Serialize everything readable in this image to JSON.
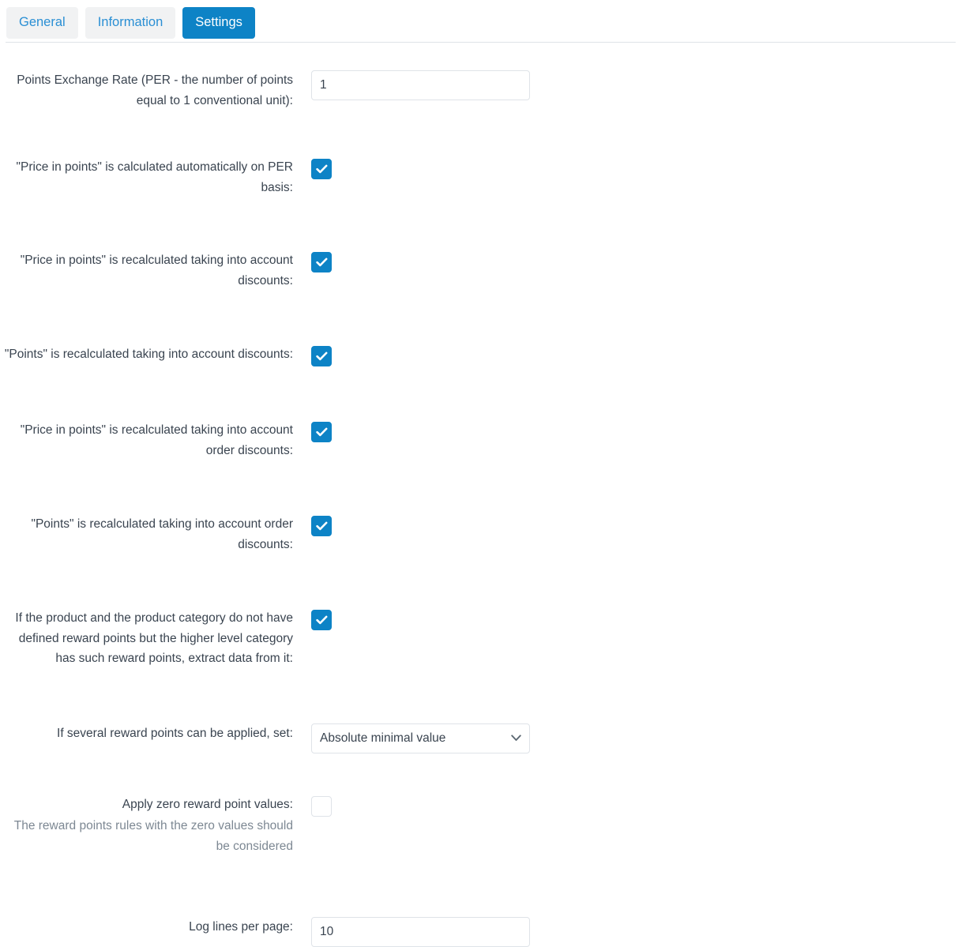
{
  "tabs": [
    {
      "id": "general",
      "label": "General",
      "active": false
    },
    {
      "id": "information",
      "label": "Information",
      "active": false
    },
    {
      "id": "settings",
      "label": "Settings",
      "active": true
    }
  ],
  "colors": {
    "accent": "#0d83c6",
    "tab_inactive_bg": "#f1f2f3",
    "tab_link": "#2a8fd4",
    "border": "#dfe3e8",
    "text": "#3a4450",
    "muted_text": "#7d8893"
  },
  "form": {
    "exchange_rate": {
      "label": "Points Exchange Rate (PER - the number of points equal to 1 conventional unit):",
      "value": "1",
      "placeholder": ""
    },
    "auto_per": {
      "label": "\"Price in points\" is calculated automatically on PER basis:",
      "checked": true
    },
    "price_points_discounts": {
      "label": "\"Price in points\" is recalculated taking into account discounts:",
      "checked": true
    },
    "points_discounts": {
      "label": "\"Points\" is recalculated taking into account discounts:",
      "checked": true
    },
    "price_points_order_discounts": {
      "label": "\"Price in points\" is recalculated taking into account order discounts:",
      "checked": true
    },
    "points_order_discounts": {
      "label": "\"Points\" is recalculated taking into account order discounts:",
      "checked": true
    },
    "parent_category": {
      "label": "If the product and the product category do not have defined reward points but the higher level category has such reward points, extract data from it:",
      "checked": true
    },
    "several_rules": {
      "label": "If several reward points can be applied, set:",
      "value": "Absolute minimal value",
      "options": [
        "Absolute minimal value"
      ]
    },
    "zero_values": {
      "label": "Apply zero reward point values:",
      "helper": "The reward points rules with the zero values should be considered",
      "checked": false
    },
    "log_lines": {
      "label": "Log lines per page:",
      "value": "10",
      "placeholder": ""
    }
  },
  "icons": {
    "check": "check-icon",
    "chevron_down": "chevron-down-icon"
  }
}
